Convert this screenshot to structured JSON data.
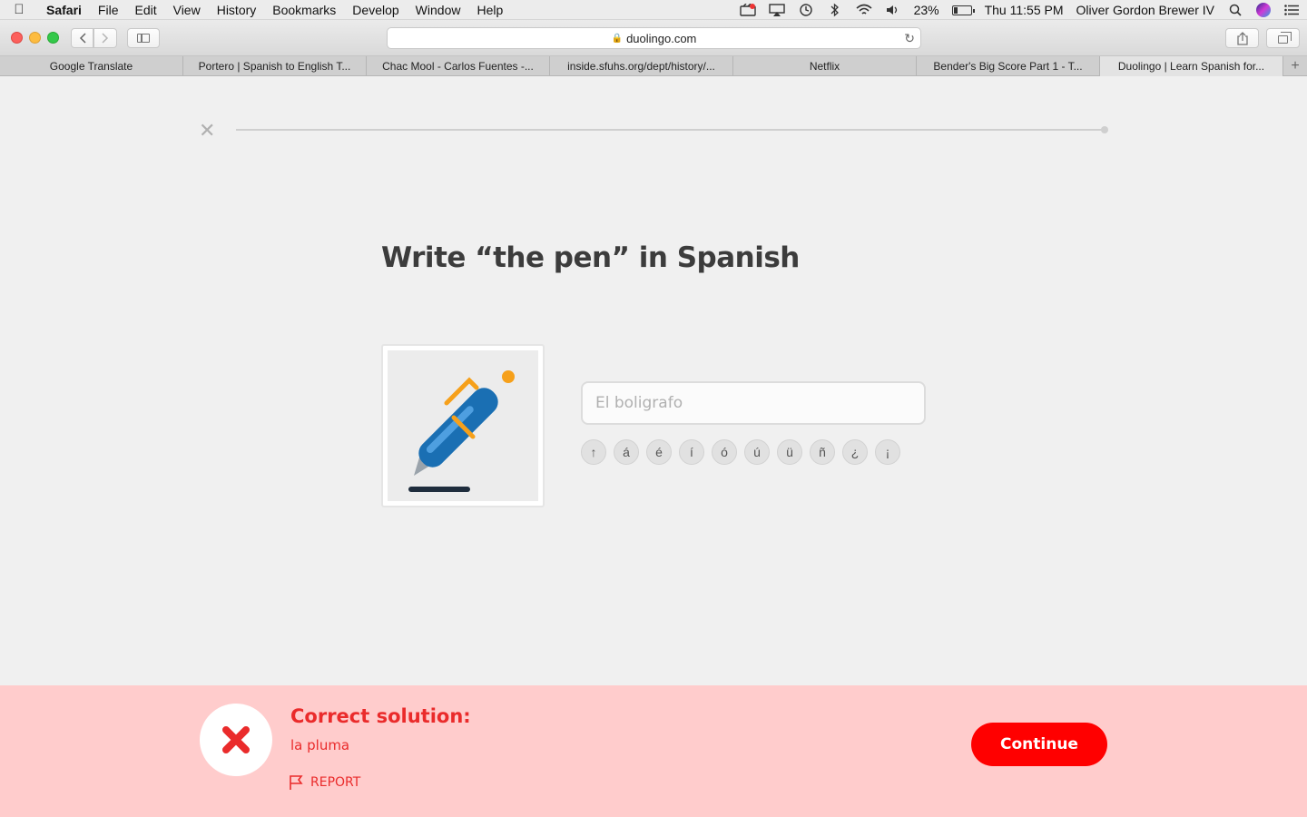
{
  "menubar": {
    "app_name": "Safari",
    "items": [
      "File",
      "Edit",
      "View",
      "History",
      "Bookmarks",
      "Develop",
      "Window",
      "Help"
    ],
    "battery_percent": "23%",
    "battery_level": 0.23,
    "clock": "Thu 11:55 PM",
    "user": "Oliver Gordon Brewer IV"
  },
  "browser": {
    "url": "duolingo.com",
    "tabs": [
      "Google Translate",
      "Portero | Spanish to English T...",
      "Chac Mool - Carlos Fuentes -...",
      "inside.sfuhs.org/dept/history/...",
      "Netflix",
      "Bender's Big Score Part 1 - T...",
      "Duolingo | Learn Spanish for..."
    ],
    "active_tab_index": 6
  },
  "lesson": {
    "prompt": "Write “the pen” in Spanish",
    "answer_value": "El boligrafo",
    "special_chars": [
      "↑",
      "á",
      "é",
      "í",
      "ó",
      "ú",
      "ü",
      "ñ",
      "¿",
      "¡"
    ]
  },
  "feedback": {
    "title": "Correct solution:",
    "solution": "la pluma",
    "report_label": "REPORT",
    "continue_label": "Continue"
  },
  "colors": {
    "feedback_bg": "#ffcccc",
    "error_red": "#ea2b2b",
    "continue_red": "#ff0000"
  }
}
